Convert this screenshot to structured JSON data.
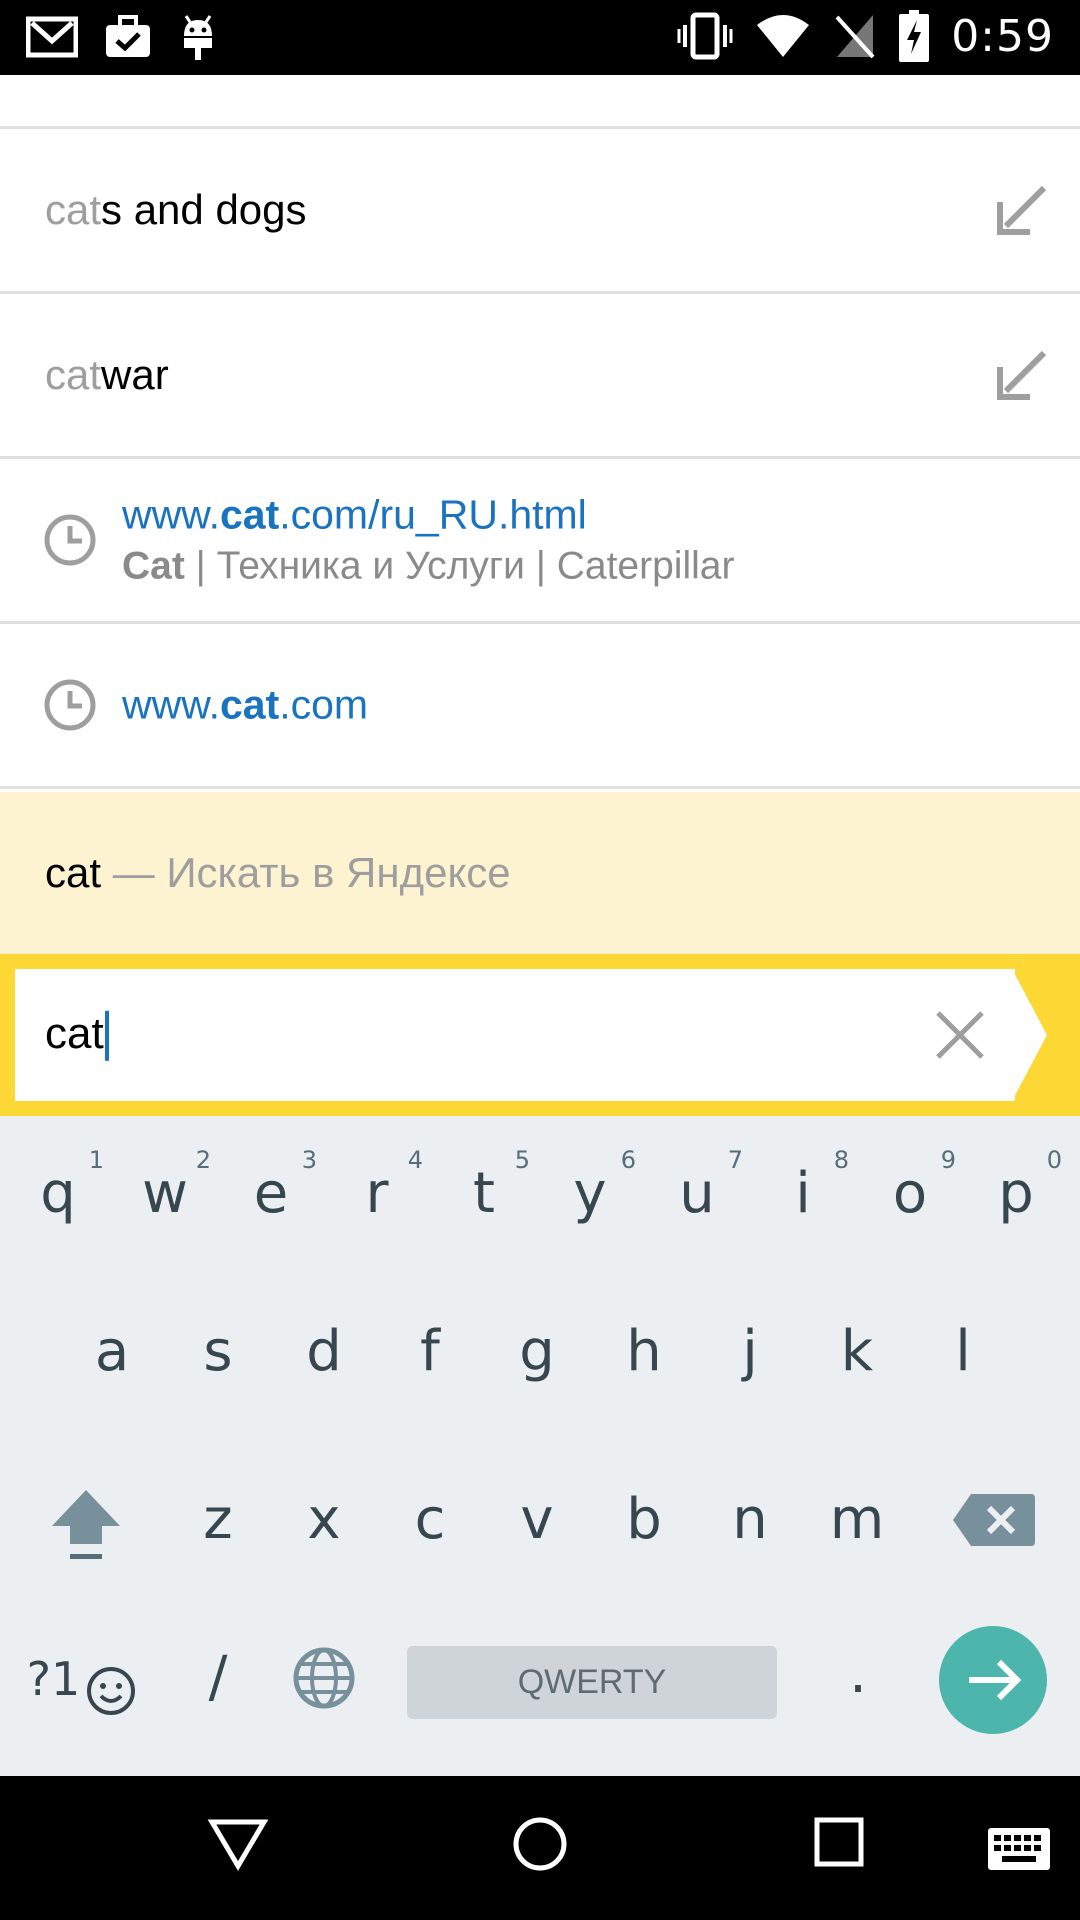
{
  "status_bar": {
    "time": "0:59",
    "left_icons": [
      "gmail-icon",
      "briefcase-check-icon",
      "android-debug-icon"
    ],
    "right_icons": [
      "vibrate-icon",
      "wifi-icon",
      "no-sim-icon",
      "battery-charging-icon"
    ]
  },
  "suggestions": [
    {
      "typed": "cat",
      "completion": "s and dogs"
    },
    {
      "typed": "cat",
      "completion": "war"
    }
  ],
  "history": [
    {
      "url_pre": "www.",
      "url_bold": "cat",
      "url_post": ".com/ru_RU.html",
      "title_bold": "Cat",
      "title_rest": " | Техника и Услуги | Caterpillar"
    },
    {
      "url_pre": "www.",
      "url_bold": "cat",
      "url_post": ".com"
    }
  ],
  "yandex_search": {
    "query": "cat",
    "hint": " — Искать в Яндексе"
  },
  "search_field": {
    "value": "cat"
  },
  "keyboard": {
    "row1": [
      {
        "k": "q",
        "h": "1"
      },
      {
        "k": "w",
        "h": "2"
      },
      {
        "k": "e",
        "h": "3"
      },
      {
        "k": "r",
        "h": "4"
      },
      {
        "k": "t",
        "h": "5"
      },
      {
        "k": "y",
        "h": "6"
      },
      {
        "k": "u",
        "h": "7"
      },
      {
        "k": "i",
        "h": "8"
      },
      {
        "k": "o",
        "h": "9"
      },
      {
        "k": "p",
        "h": "0"
      }
    ],
    "row2": [
      "a",
      "s",
      "d",
      "f",
      "g",
      "h",
      "j",
      "k",
      "l"
    ],
    "row3": [
      "z",
      "x",
      "c",
      "v",
      "b",
      "n",
      "m"
    ],
    "symbols_label": "?1",
    "slash_label": "/",
    "space_label": "QWERTY",
    "period_label": "."
  },
  "accent_colors": {
    "yandex_yellow": "#fdd835",
    "suggest_bg": "#fdf3d0",
    "link_blue": "#1a73c0",
    "enter_teal": "#4db6ac"
  }
}
